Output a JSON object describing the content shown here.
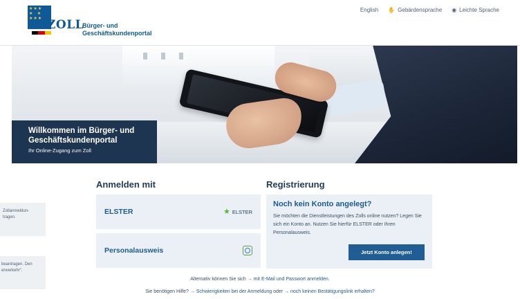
{
  "header": {
    "logo_word": "ZOLL",
    "logo_line1": "Bürger- und",
    "logo_line2": "Geschäftskundenportal",
    "links": [
      {
        "label": "English",
        "icon": ""
      },
      {
        "label": "Gebärdensprache",
        "icon": "sign-language-icon"
      },
      {
        "label": "Leichte Sprache",
        "icon": "easy-language-icon"
      }
    ]
  },
  "hero": {
    "title_line1": "Willkommen im Bürger- und",
    "title_line2": "Geschäftskundenportal",
    "subtitle": "Ihr Online-Zugang zum Zoll"
  },
  "side_boxes": [
    {
      "line1": "Zollanmeldun-",
      "line2": "tragen."
    },
    {
      "line1": "beantragen. Den",
      "line2": "enverkehr\"."
    }
  ],
  "login": {
    "title": "Anmelden mit",
    "elster_label": "ELSTER",
    "elster_badge": "ELSTER",
    "ausweis_label": "Personalausweis"
  },
  "registration": {
    "title": "Registrierung",
    "card_title": "Noch kein Konto angelegt?",
    "text": "Sie möchten die Dienstleistungen des Zolls online nutzen? Legen Sie sich ein Konto an. Nutzen Sie hierfür ELSTER oder Ihren Personalausweis.",
    "button": "Jetzt Konto anlegen!"
  },
  "footer": {
    "alt_prefix": "Alternativ können Sie sich",
    "alt_link": "→ mit E-Mail und Passwort anmelden.",
    "help_prefix": "Sie benötigen Hilfe?",
    "help_link1": "→ Schwierigkeiten bei der Anmeldung",
    "help_mid": "oder",
    "help_link2": "→ noch keinen Bestätigungslink erhalten?"
  },
  "colors": {
    "brand_blue": "#0f5a96",
    "dark_navy": "#1d3550",
    "card_bg": "#eaf0f5",
    "button": "#1f5d94",
    "elster_green": "#5cb531"
  }
}
